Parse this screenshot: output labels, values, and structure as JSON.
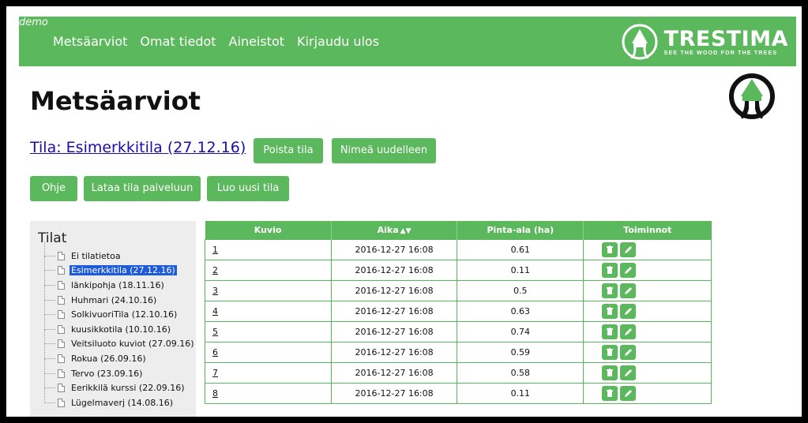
{
  "header": {
    "demo_label": "demo",
    "nav": [
      "Metsäarviot",
      "Omat tiedot",
      "Aineistot",
      "Kirjaudu ulos"
    ],
    "logo_name": "TRESTIMA",
    "logo_tagline": "SEE THE WOOD FOR THE TREES"
  },
  "page": {
    "title": "Metsäarviot",
    "tila_link": "Tila: Esimerkkitila (27.12.16)",
    "buttons": {
      "delete": "Poista tila",
      "rename": "Nimeä uudelleen",
      "help": "Ohje",
      "download": "Lataa tila palveluun",
      "create": "Luo uusi tila"
    }
  },
  "sidebar": {
    "title": "Tilat",
    "items": [
      "Ei tilatietoa",
      "Esimerkkitila (27.12.16)",
      "länkipohja (18.11.16)",
      "Huhmari (24.10.16)",
      "SolkivuoriTila (12.10.16)",
      "kuusikkotila (10.10.16)",
      "Veitsiluoto kuviot (27.09.16)",
      "Rokua (26.09.16)",
      "Tervo (23.09.16)",
      "Eerikkilä kurssi (22.09.16)",
      "Lügelmaverj (14.08.16)"
    ],
    "selected": "Esimerkkitila (27.12.16)"
  },
  "table": {
    "headers": [
      "Kuvio",
      "Aika",
      "Pinta-ala (ha)",
      "Toiminnot"
    ],
    "sort_icon": "sort-icon",
    "rows": [
      {
        "kuvio": "1",
        "aika": "2016-12-27 16:08",
        "ala": "0.61"
      },
      {
        "kuvio": "2",
        "aika": "2016-12-27 16:08",
        "ala": "0.11"
      },
      {
        "kuvio": "3",
        "aika": "2016-12-27 16:08",
        "ala": "0.5"
      },
      {
        "kuvio": "4",
        "aika": "2016-12-27 16:08",
        "ala": "0.63"
      },
      {
        "kuvio": "5",
        "aika": "2016-12-27 16:08",
        "ala": "0.74"
      },
      {
        "kuvio": "6",
        "aika": "2016-12-27 16:08",
        "ala": "0.59"
      },
      {
        "kuvio": "7",
        "aika": "2016-12-27 16:08",
        "ala": "0.58"
      },
      {
        "kuvio": "8",
        "aika": "2016-12-27 16:08",
        "ala": "0.11"
      }
    ]
  },
  "colors": {
    "accent": "#5cb85c",
    "selection": "#1e5bd8",
    "link": "#1a0dab"
  }
}
